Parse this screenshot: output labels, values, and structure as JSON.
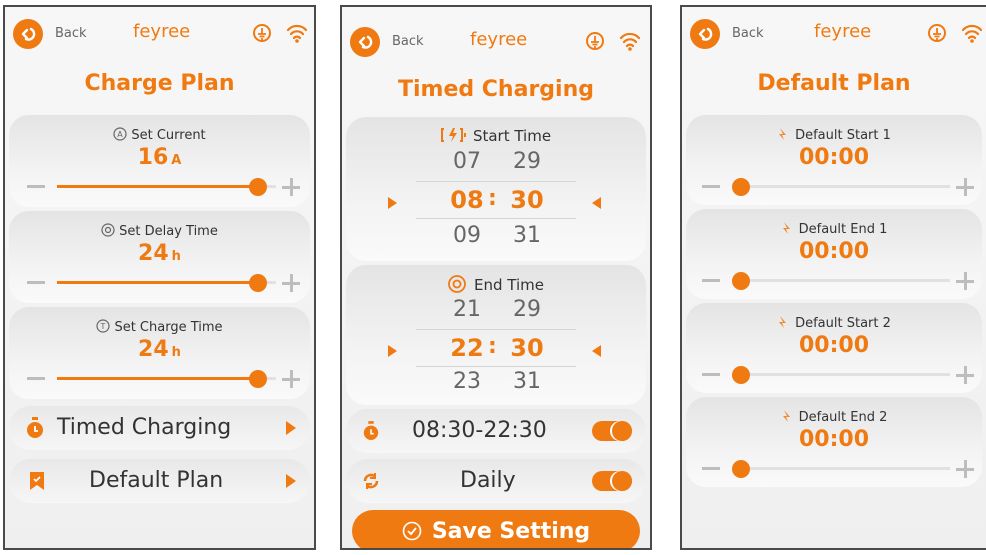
{
  "header": {
    "back_label": "Back",
    "brand": "feyree"
  },
  "charge_plan": {
    "title": "Charge Plan",
    "settings": [
      {
        "label": "Set Current",
        "value": "16",
        "unit": "A",
        "level": 1.0
      },
      {
        "label": "Set Delay Time",
        "value": "24",
        "unit": "h",
        "level": 1.0
      },
      {
        "label": "Set Charge Time",
        "value": "24",
        "unit": "h",
        "level": 1.0
      }
    ],
    "menu": [
      {
        "label": "Timed Charging"
      },
      {
        "label": "Default Plan"
      }
    ]
  },
  "timed_charging": {
    "title": "Timed Charging",
    "start": {
      "label": "Start Time",
      "hours": [
        "07",
        "08",
        "09"
      ],
      "minutes": [
        "29",
        "30",
        "31"
      ],
      "colon": ":"
    },
    "end": {
      "label": "End Time",
      "hours": [
        "21",
        "22",
        "23"
      ],
      "minutes": [
        "29",
        "30",
        "31"
      ],
      "colon": ":"
    },
    "range": "08:30-22:30",
    "repeat": "Daily",
    "save_label": "Save Setting"
  },
  "default_plan": {
    "title": "Default Plan",
    "items": [
      {
        "label": "Default Start 1",
        "value": "00:00",
        "level": 0.0
      },
      {
        "label": "Default End 1",
        "value": "00:00",
        "level": 0.0
      },
      {
        "label": "Default Start 2",
        "value": "00:00",
        "level": 0.0
      },
      {
        "label": "Default End 2",
        "value": "00:00",
        "level": 0.0
      }
    ]
  },
  "colors": {
    "accent": "#f07a12",
    "text": "#333333",
    "muted": "#bdbdbd"
  }
}
